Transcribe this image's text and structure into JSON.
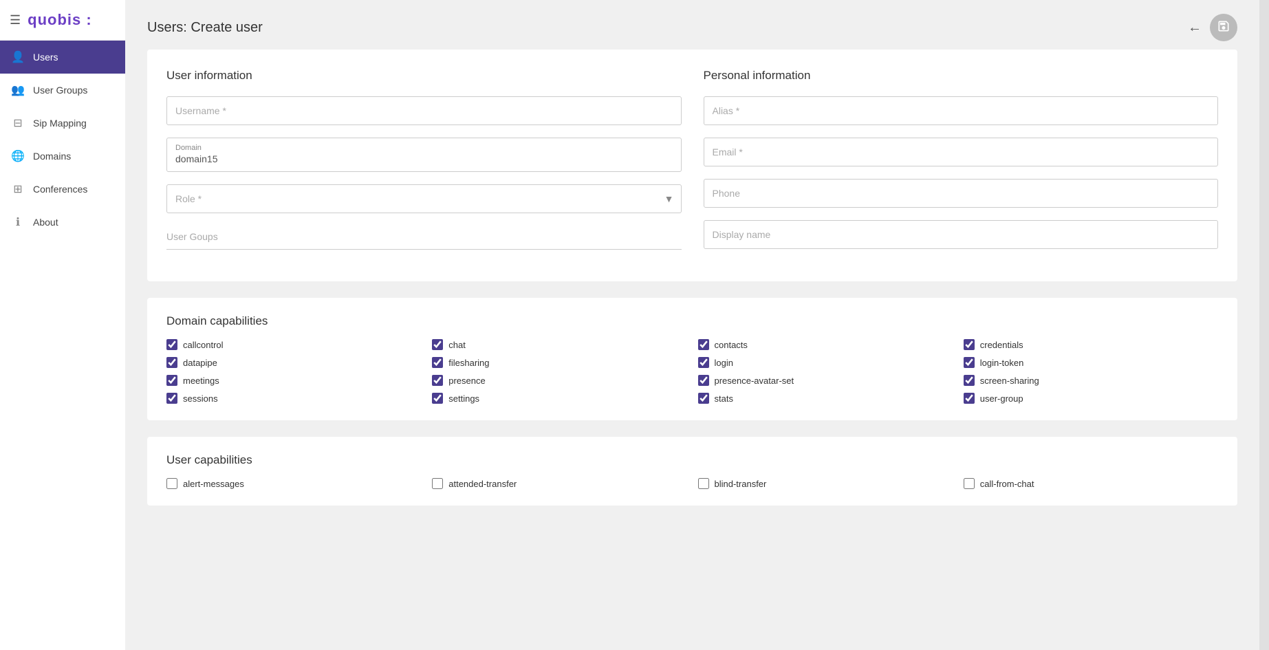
{
  "app": {
    "logo": "quobis :",
    "title": "Users: Create user"
  },
  "sidebar": {
    "items": [
      {
        "id": "users",
        "label": "Users",
        "icon": "👤",
        "active": true
      },
      {
        "id": "user-groups",
        "label": "User Groups",
        "icon": "👥",
        "active": false
      },
      {
        "id": "sip-mapping",
        "label": "Sip Mapping",
        "icon": "⊟",
        "active": false
      },
      {
        "id": "domains",
        "label": "Domains",
        "icon": "🌐",
        "active": false
      },
      {
        "id": "conferences",
        "label": "Conferences",
        "icon": "⊞",
        "active": false
      },
      {
        "id": "about",
        "label": "About",
        "icon": "ℹ",
        "active": false
      }
    ]
  },
  "user_info": {
    "section_title": "User information",
    "username_placeholder": "Username *",
    "domain_label": "Domain",
    "domain_value": "domain15",
    "role_placeholder": "Role *",
    "user_groups_placeholder": "User Goups"
  },
  "personal_info": {
    "section_title": "Personal information",
    "alias_placeholder": "Alias *",
    "email_placeholder": "Email *",
    "phone_placeholder": "Phone",
    "display_name_placeholder": "Display name"
  },
  "domain_capabilities": {
    "section_title": "Domain capabilities",
    "items": [
      {
        "label": "callcontrol",
        "checked": true
      },
      {
        "label": "chat",
        "checked": true
      },
      {
        "label": "contacts",
        "checked": true
      },
      {
        "label": "credentials",
        "checked": true
      },
      {
        "label": "datapipe",
        "checked": true
      },
      {
        "label": "filesharing",
        "checked": true
      },
      {
        "label": "login",
        "checked": true
      },
      {
        "label": "login-token",
        "checked": true
      },
      {
        "label": "meetings",
        "checked": true
      },
      {
        "label": "presence",
        "checked": true
      },
      {
        "label": "presence-avatar-set",
        "checked": true
      },
      {
        "label": "screen-sharing",
        "checked": true
      },
      {
        "label": "sessions",
        "checked": true
      },
      {
        "label": "settings",
        "checked": true
      },
      {
        "label": "stats",
        "checked": true
      },
      {
        "label": "user-group",
        "checked": true
      }
    ]
  },
  "user_capabilities": {
    "section_title": "User capabilities",
    "items": [
      {
        "label": "alert-messages",
        "checked": false
      },
      {
        "label": "attended-transfer",
        "checked": false
      },
      {
        "label": "blind-transfer",
        "checked": false
      },
      {
        "label": "call-from-chat",
        "checked": false
      }
    ]
  },
  "actions": {
    "back_label": "←",
    "save_icon": "💾"
  }
}
